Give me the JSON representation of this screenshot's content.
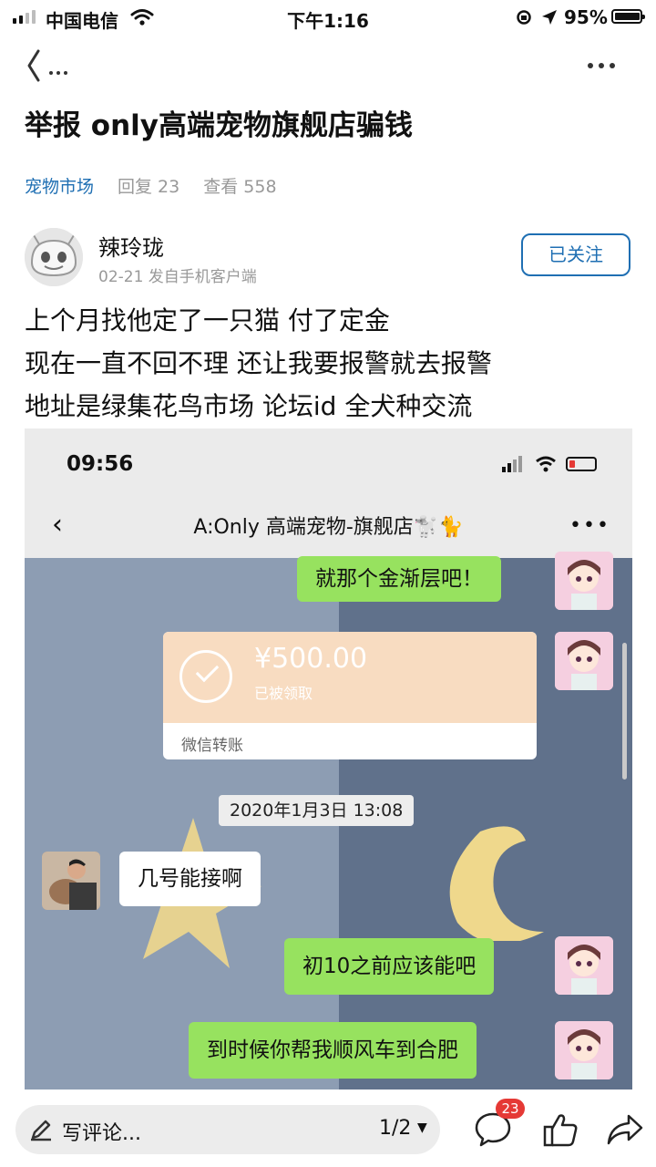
{
  "status_bar": {
    "carrier": "中国电信",
    "time": "下午1:16",
    "battery": "95%"
  },
  "post": {
    "title": "举报 only高端宠物旗舰店骗钱",
    "category": "宠物市场",
    "replies": "回复 23",
    "views": "查看 558",
    "author": "辣玲珑",
    "post_info": "02-21 发自手机客户端",
    "follow_label": "已关注",
    "body_lines": [
      "上个月找他定了一只猫 付了定金",
      "现在一直不回不理 还让我要报警就去报警",
      "地址是绿集花鸟市场 论坛id 全犬种交流"
    ]
  },
  "screenshot": {
    "time": "09:56",
    "chat_title": "A:Only 高端宠物-旗舰店🐩🐈",
    "messages": {
      "m1": "就那个金渐层吧！",
      "transfer_amount": "¥500.00",
      "transfer_status": "已被领取",
      "transfer_label": "微信转账",
      "date": "2020年1月3日 13:08",
      "m2": "几号能接啊",
      "m3": "初10之前应该能吧",
      "m4": "到时候你帮我顺风车到合肥"
    }
  },
  "bottom_bar": {
    "comment_placeholder": "写评论...",
    "pager": "1/2",
    "comment_count": "23"
  },
  "colors": {
    "link_blue": "#1f6fb3",
    "wechat_green": "#97e25f",
    "badge_red": "#e53935"
  },
  "icons": [
    "back-icon",
    "more-icon",
    "pen-icon",
    "comment-icon",
    "like-icon",
    "share-icon",
    "check-icon"
  ]
}
